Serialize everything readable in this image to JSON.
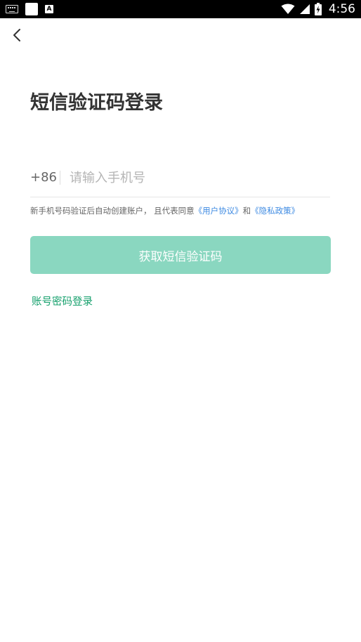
{
  "status_bar": {
    "a_badge": "A",
    "time": "4:56"
  },
  "header": {
    "title": "短信验证码登录"
  },
  "phone": {
    "country_code": "+86",
    "placeholder": "请输入手机号",
    "value": ""
  },
  "agreement": {
    "prefix": "新手机号码验证后自动创建账户， 且代表同意",
    "user_agreement": "《用户协议》",
    "conjunction": "和",
    "privacy_policy": "《隐私政策》"
  },
  "actions": {
    "get_code_label": "获取短信验证码",
    "password_login_label": "账号密码登录"
  },
  "colors": {
    "button_bg": "#8ad7c0",
    "link_blue": "#3d8ae2",
    "link_green": "#15a06c"
  }
}
